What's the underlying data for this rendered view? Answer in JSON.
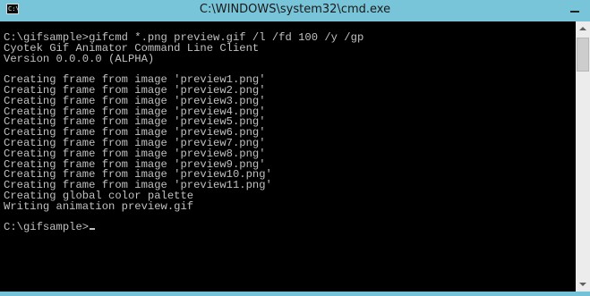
{
  "window": {
    "title": "C:\\WINDOWS\\system32\\cmd.exe",
    "icon_text": "C:\\",
    "colors": {
      "frame": "#73c2d7",
      "console_bg": "#000000",
      "console_text": "#c0c0c0"
    }
  },
  "console": {
    "lines": [
      "C:\\gifsample>gifcmd *.png preview.gif /l /fd 100 /y /gp",
      "Cyotek Gif Animator Command Line Client",
      "Version 0.0.0.0 (ALPHA)",
      "",
      "Creating frame from image 'preview1.png'",
      "Creating frame from image 'preview2.png'",
      "Creating frame from image 'preview3.png'",
      "Creating frame from image 'preview4.png'",
      "Creating frame from image 'preview5.png'",
      "Creating frame from image 'preview6.png'",
      "Creating frame from image 'preview7.png'",
      "Creating frame from image 'preview8.png'",
      "Creating frame from image 'preview9.png'",
      "Creating frame from image 'preview10.png'",
      "Creating frame from image 'preview11.png'",
      "Creating global color palette",
      "Writing animation preview.gif",
      "",
      "C:\\gifsample>"
    ]
  },
  "icons": {
    "app": "console-app-icon",
    "minimize": "minimize-icon",
    "scroll_up": "scroll-up-arrow-icon",
    "scroll_down": "scroll-down-arrow-icon"
  }
}
